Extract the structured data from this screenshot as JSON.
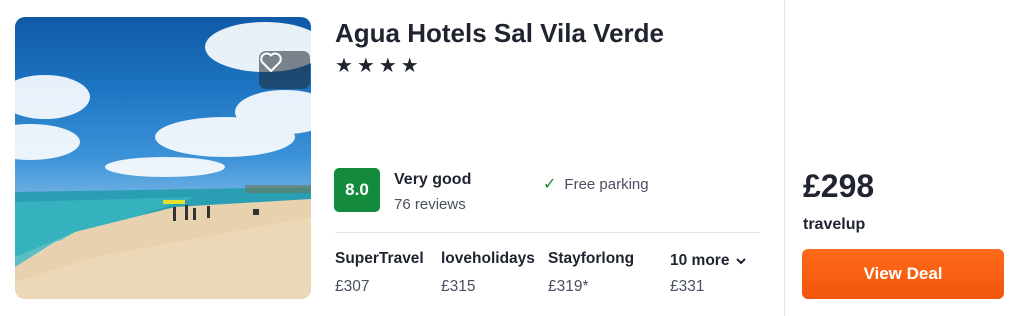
{
  "hotel": {
    "name": "Agua Hotels Sal Vila Verde",
    "stars": "★★★★",
    "score": "8.0",
    "rating_word": "Very good",
    "reviews": "76 reviews",
    "amenity": "Free parking"
  },
  "providers": [
    {
      "name": "SuperTravel",
      "price": "£307"
    },
    {
      "name": "loveholidays",
      "price": "£315"
    },
    {
      "name": "Stayforlong",
      "price": "£319*"
    }
  ],
  "more": {
    "label": "10 more",
    "price": "£331"
  },
  "deal": {
    "price": "£298",
    "provider": "travelup",
    "button_label": "View Deal"
  },
  "colors": {
    "score_bg": "#148a3c",
    "button_bg": "#f1560a"
  },
  "icons": {
    "favorite": "heart-icon",
    "amenity": "check-icon",
    "more": "chevron-down-icon"
  }
}
